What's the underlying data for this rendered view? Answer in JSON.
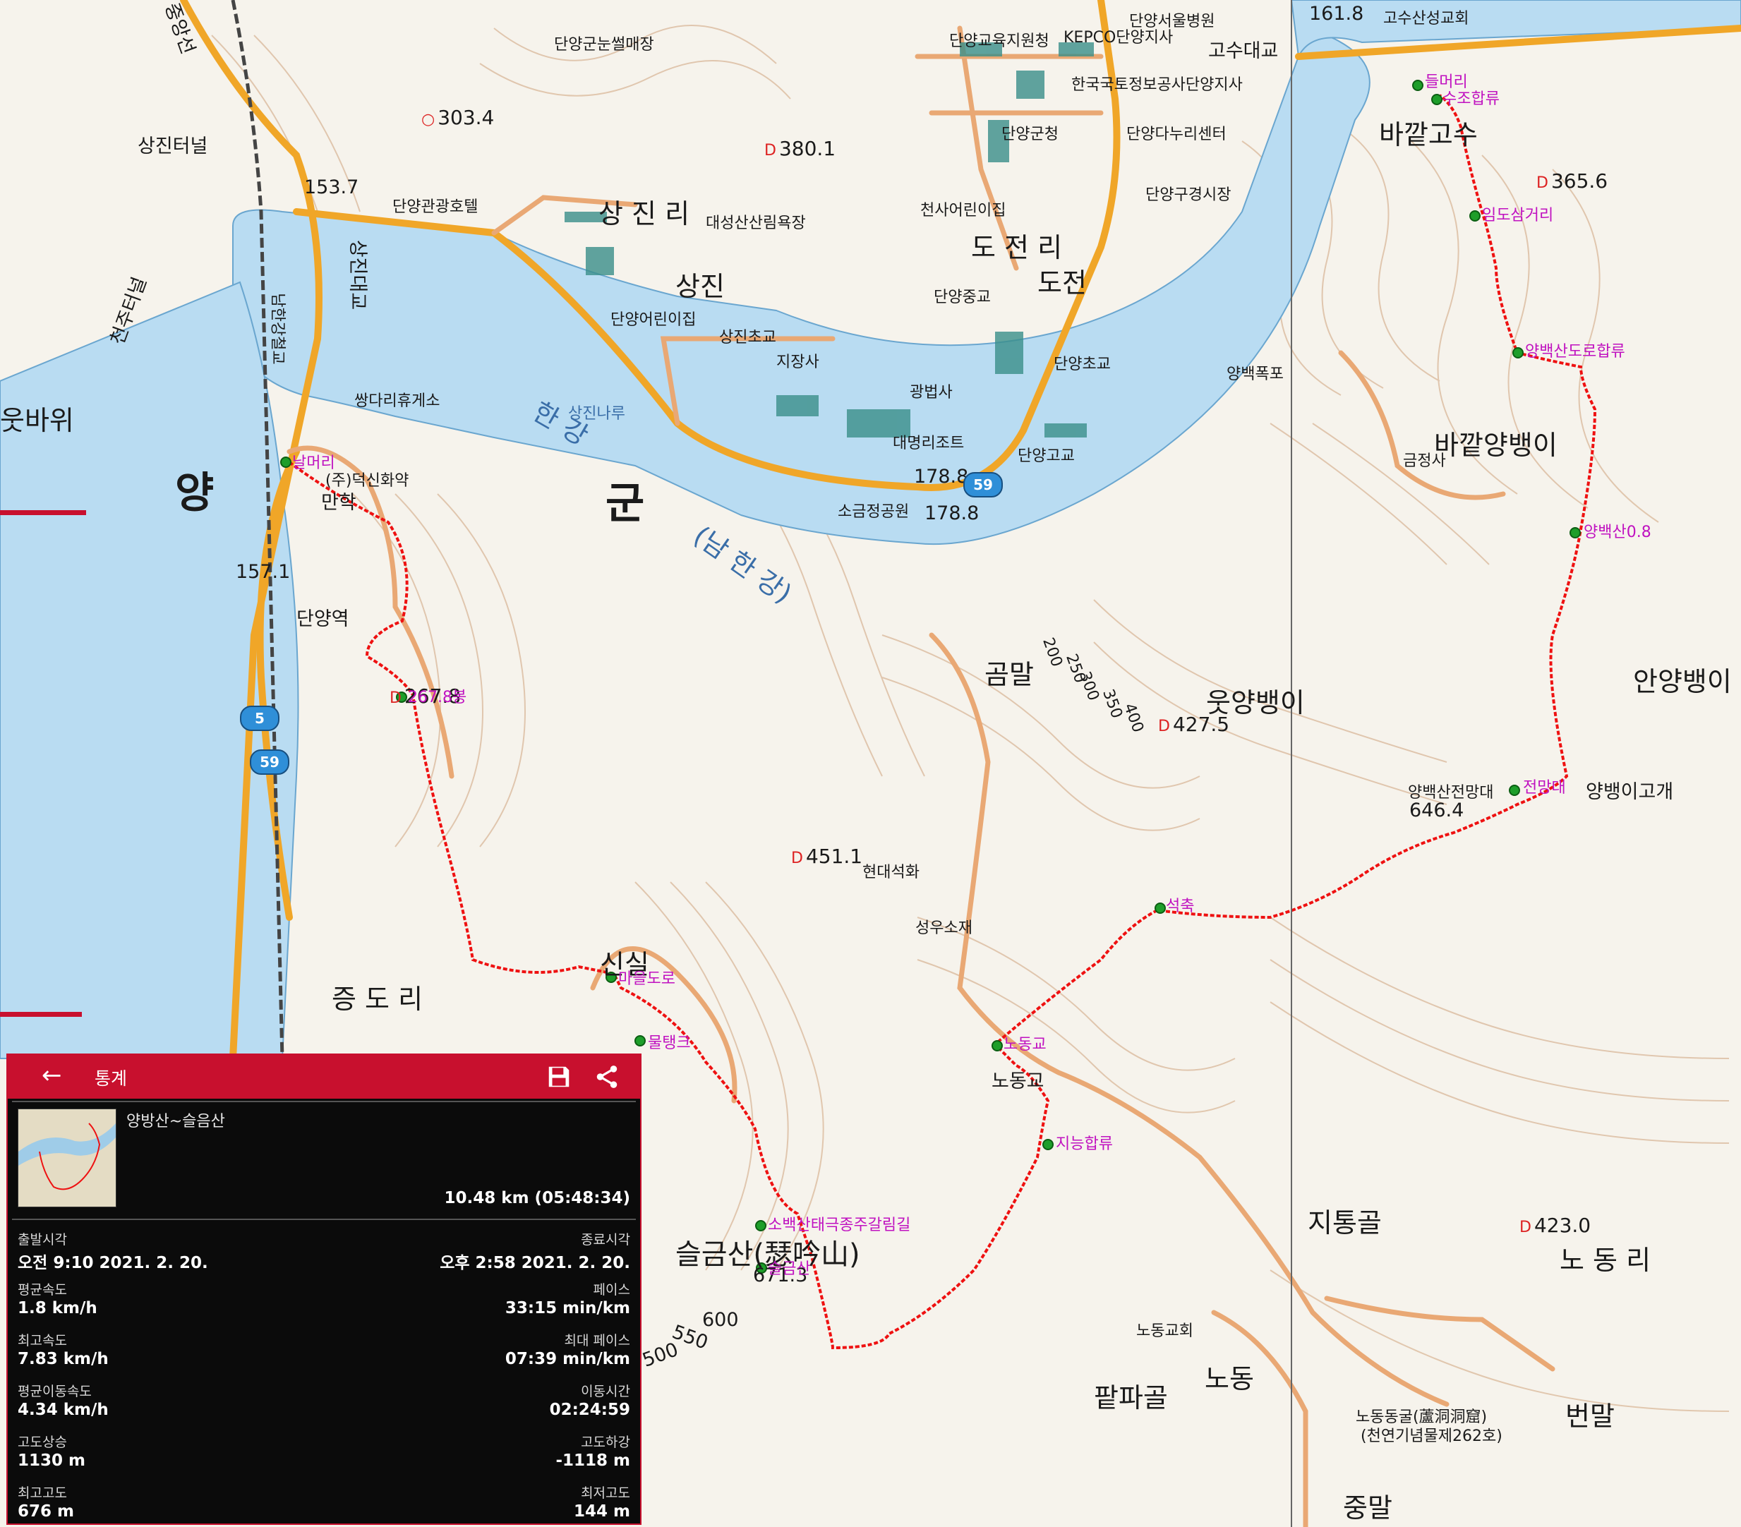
{
  "map": {
    "colors": {
      "water": "#b9dcf2",
      "road": "#f0a628",
      "minor_road": "#e9a874",
      "track": "#ee1111",
      "contour": "#d9b89a",
      "background": "#f6f3ec"
    },
    "labels": {
      "yang": "양",
      "gun": "군",
      "hangang": "한 강",
      "namhangang": "(남 한 강)",
      "sangjinri": "상 진 리",
      "sangjin": "상진",
      "dojeonri": "도 전 리",
      "dojeon": "도전",
      "jeungdori": "증 도 리",
      "nodongri": "노 동 리",
      "seulgeumsan": "슬금산(瑟吟山)",
      "baggatgosu": "바깥고수",
      "baggatyangbaengi": "바깥양뱅이",
      "anyangbaengi": "안양뱅이",
      "utyangbaengi": "웃양뱅이",
      "yangbaengigogae": "양뱅이고개",
      "gommal": "곰말",
      "sinsil": "신실",
      "jitonggol": "지통골",
      "paltpagol": "팥파골",
      "nodong": "노동",
      "jungmal": "중말",
      "beonmal": "번말",
      "nodonggyo": "노동교",
      "utbawi": "웃바위",
      "danyangstation": "단양역",
      "maneori": "만학",
      "sangjintunnel": "상진터널",
      "sangjindaegyo": "상진대교",
      "namhangangbridge": "남한강철교",
      "gosudaegyo": "고수대교",
      "gosusanseong": "고수산성교회",
      "seoulhospital": "단양서울병원",
      "edu": "단양교육지원청",
      "kepco": "KEPCO단양지사",
      "lh": "한국국토정보공사단양지사",
      "gunhall": "단양군청",
      "nuri": "단양다누리센터",
      "oldmarket": "단양구경시장",
      "angel": "천사어린이집",
      "sledding": "단양군눈썰매장",
      "forest": "대성산산림욕장",
      "hotel": "단양관광호텔",
      "kinder": "단양어린이집",
      "sangjinelem": "상진초교",
      "jijangsa": "지장사",
      "sangjinnaru": "상진나루",
      "middle": "단양중교",
      "elem": "단양초교",
      "high": "단양고교",
      "gwangbeopsa": "광법사",
      "daemyung": "대명리조트",
      "sogeumjeong": "소금정공원",
      "rest": "쌍다리휴게소",
      "deoksin": "(주)덕신화약",
      "yangbaek_falls": "양백폭포",
      "geumjeongsa": "금정사",
      "hyundai": "현대석화",
      "seongwoo": "성우소재",
      "nodongchurch": "노동교회",
      "cave": "노동동굴(蘆洞洞窟)",
      "cave_sub": "(천연기념물제262호)",
      "chungang": "중앙선",
      "cheonju": "천주터널",
      "peaks": [
        "303.4",
        "380.1",
        "365.6",
        "427.5",
        "451.1",
        "423.0",
        "267.8"
      ],
      "alts": [
        "153.7",
        "178.8",
        "178.8",
        "157.1",
        "161.8",
        "646.4",
        "671.3"
      ],
      "contour_labels": [
        "200",
        "250",
        "300",
        "350",
        "400",
        "600",
        "550",
        "500"
      ],
      "routes": [
        "5",
        "59",
        "59"
      ]
    },
    "waypoints": [
      "들머리",
      "수조합류",
      "임도삼거리",
      "양백산도로합류",
      "양백산0.8",
      "전망대",
      "양백산전망대",
      "석축",
      "노동교",
      "지능합류",
      "소백산태극종주갈림길",
      "슬금산",
      "물탱크",
      "마을도로",
      "날머리",
      "267.8봉"
    ]
  },
  "panel": {
    "header_title": "통계",
    "back_icon": "←",
    "track_name": "양방산~슬음산",
    "total": "10.48 km (05:48:34)",
    "stats": [
      {
        "left_label": "출발시각",
        "left_value": "오전 9:10 2021. 2. 20.",
        "right_label": "종료시각",
        "right_value": "오후 2:58 2021. 2. 20."
      },
      {
        "left_label": "평균속도",
        "left_value": "1.8 km/h",
        "right_label": "페이스",
        "right_value": "33:15 min/km"
      },
      {
        "left_label": "최고속도",
        "left_value": "7.83 km/h",
        "right_label": "최대 페이스",
        "right_value": "07:39 min/km"
      },
      {
        "left_label": "평균이동속도",
        "left_value": "4.34 km/h",
        "right_label": "이동시간",
        "right_value": "02:24:59"
      },
      {
        "left_label": "고도상승",
        "left_value": "1130 m",
        "right_label": "고도하강",
        "right_value": "-1118 m"
      },
      {
        "left_label": "최고고도",
        "left_value": "676 m",
        "right_label": "최저고도",
        "right_value": "144 m"
      }
    ]
  }
}
